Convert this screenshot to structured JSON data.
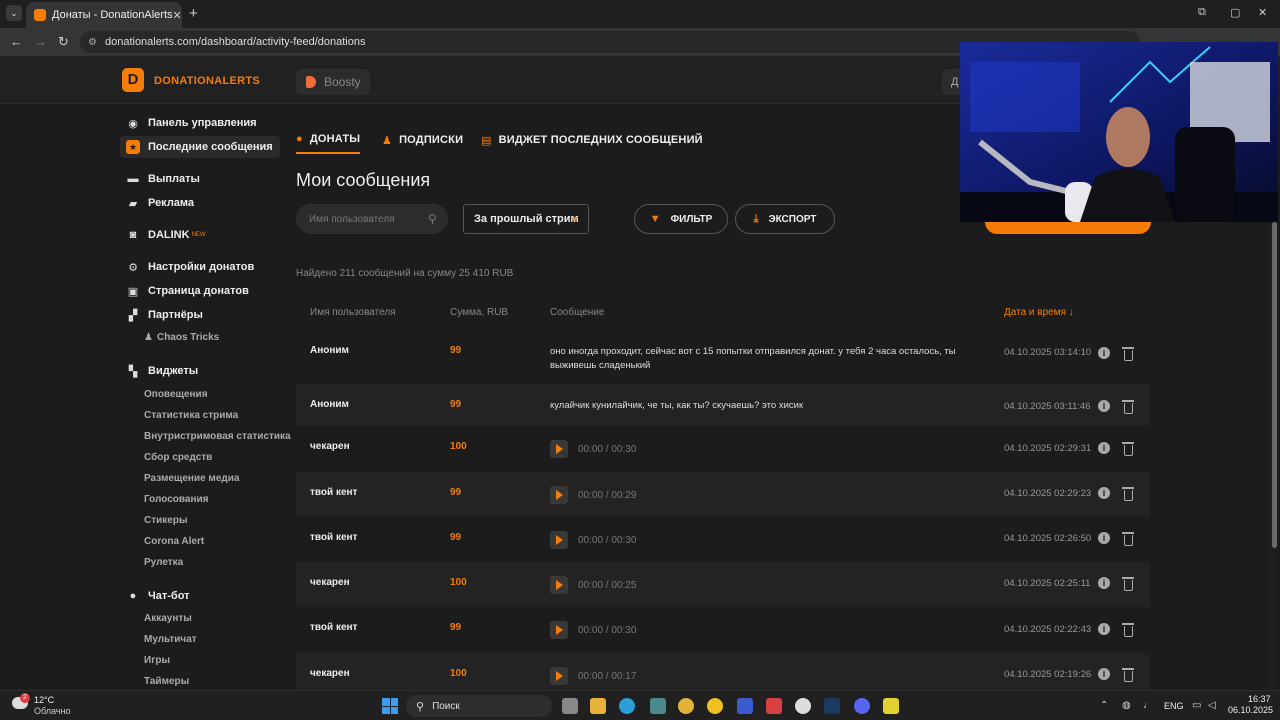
{
  "browser": {
    "tab_title": "Донаты - DonationAlerts",
    "tab_close": "✕",
    "new_tab": "+",
    "url": "donationalerts.com/dashboard/activity-feed/donations"
  },
  "header": {
    "brand": "DONATIONALERTS",
    "logo_glyph": "D",
    "boosty_label": "Boosty",
    "right_btn_label": "Д"
  },
  "sidebar": {
    "items": [
      {
        "label": "Панель управления",
        "icon": "dashboard-icon"
      },
      {
        "label": "Последние сообщения",
        "icon": "star-icon"
      },
      {
        "label": "Выплаты",
        "icon": "wallet-icon"
      },
      {
        "label": "Реклама",
        "icon": "ad-icon"
      },
      {
        "label": "DALINK",
        "icon": "dalink-icon",
        "badge": "NEW"
      },
      {
        "label": "Настройки донатов",
        "icon": "gear-icon"
      },
      {
        "label": "Страница донатов",
        "icon": "page-icon"
      },
      {
        "label": "Партнёры",
        "icon": "partners-icon"
      },
      {
        "label": "Виджеты",
        "icon": "widgets-icon"
      },
      {
        "label": "Чат-бот",
        "icon": "chat-icon"
      }
    ],
    "partners_sub": "Chaos Tricks",
    "widgets_sub": [
      "Оповещения",
      "Статистика стрима",
      "Внутристримовая статистика",
      "Сбор средств",
      "Размещение медиа",
      "Голосования",
      "Стикеры",
      "Corona Alert",
      "Рулетка"
    ],
    "chatbot_sub": [
      "Аккаунты",
      "Мультичат",
      "Игры",
      "Таймеры"
    ]
  },
  "tabs": [
    {
      "label": "ДОНАТЫ",
      "active": true
    },
    {
      "label": "ПОДПИСКИ",
      "active": false
    },
    {
      "label": "ВИДЖЕТ ПОСЛЕДНИХ СООБЩЕНИЙ",
      "active": false
    }
  ],
  "page_title": "Мои сообщения",
  "filters": {
    "search_placeholder": "Имя пользователя",
    "period_selected": "За прошлый стрим",
    "filter_label": "ФИЛЬТР",
    "export_label": "ЭКСПОРТ"
  },
  "summary": "Найдено 211 сообщений на сумму 25 410 RUB",
  "table": {
    "headers": {
      "user": "Имя пользователя",
      "amount": "Сумма, RUB",
      "message": "Сообщение",
      "date": "Дата и время ↓"
    },
    "rows": [
      {
        "user": "Аноним",
        "amount": "99",
        "message": "оно иногда проходит, сейчас вот с 15 попытки отправился донат. у тебя 2 часа осталось, ты выживешь сладенький",
        "date": "04.10.2025 03:14:10"
      },
      {
        "user": "Аноним",
        "amount": "99",
        "message": "кулайчик кунилайчик, че ты, как ты? скучаешь? это хисик",
        "date": "04.10.2025 03:11:46"
      },
      {
        "user": "чекарен",
        "amount": "100",
        "duration": "00:00 / 00:30",
        "date": "04.10.2025 02:29:31"
      },
      {
        "user": "твой кент",
        "amount": "99",
        "duration": "00:00 / 00:29",
        "date": "04.10.2025 02:29:23"
      },
      {
        "user": "твой кент",
        "amount": "99",
        "duration": "00:00 / 00:30",
        "date": "04.10.2025 02:26:50"
      },
      {
        "user": "чекарен",
        "amount": "100",
        "duration": "00:00 / 00:25",
        "date": "04.10.2025 02:25:11"
      },
      {
        "user": "твой кент",
        "amount": "99",
        "duration": "00:00 / 00:30",
        "date": "04.10.2025 02:22:43"
      },
      {
        "user": "чекарен",
        "amount": "100",
        "duration": "00:00 / 00:17",
        "date": "04.10.2025 02:19:26"
      }
    ]
  },
  "taskbar": {
    "temp": "12°C",
    "weather": "Облачно",
    "weather_badge": "2",
    "search_label": "Поиск",
    "lang": "ENG",
    "time": "16:37",
    "date": "06.10.2025"
  },
  "colors": {
    "accent": "#f57d07",
    "bg": "#1c1c1c"
  }
}
